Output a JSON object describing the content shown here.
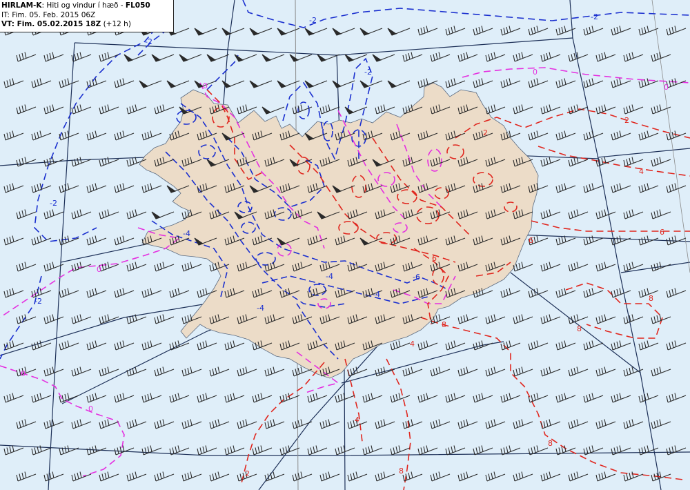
{
  "header": {
    "model": "HIRLAM-K",
    "subtitle": ": Hiti og vindur í hæð - ",
    "level": "FL050",
    "it_label": "IT: Fim. 05. Feb. 2015 06Z",
    "vt_label": "VT: Fim. 05.02.2015 18Z",
    "vt_lead": " (+12 h)"
  },
  "colors": {
    "sea": "#dfeef9",
    "land": "#ecdcc8",
    "grid": "#1c2f57",
    "meridian": "#8a8a8a",
    "cold_contour": "#1a2fcf",
    "zero_contour": "#e52fe0",
    "warm_contour": "#e0261e",
    "barb": "#2a2a2a"
  },
  "contour_labels": [
    {
      "text": "-2",
      "color": "cold"
    },
    {
      "text": "-2",
      "color": "cold"
    },
    {
      "text": "-2",
      "color": "cold"
    },
    {
      "text": "-2",
      "color": "cold"
    },
    {
      "text": "-2",
      "color": "cold"
    },
    {
      "text": "-2",
      "color": "cold"
    },
    {
      "text": "-4",
      "color": "cold"
    },
    {
      "text": "-4",
      "color": "cold"
    },
    {
      "text": "-4",
      "color": "cold"
    },
    {
      "text": "-4",
      "color": "cold"
    },
    {
      "text": "-6",
      "color": "cold"
    },
    {
      "text": "0",
      "color": "zero"
    },
    {
      "text": "0",
      "color": "zero"
    },
    {
      "text": "0",
      "color": "zero"
    },
    {
      "text": "0",
      "color": "zero"
    },
    {
      "text": "0",
      "color": "zero"
    },
    {
      "text": "0",
      "color": "zero"
    },
    {
      "text": "2",
      "color": "warm"
    },
    {
      "text": "2",
      "color": "warm"
    },
    {
      "text": "2",
      "color": "warm"
    },
    {
      "text": "4",
      "color": "warm"
    },
    {
      "text": "4",
      "color": "warm"
    },
    {
      "text": "4",
      "color": "warm"
    },
    {
      "text": "6",
      "color": "warm"
    },
    {
      "text": "6",
      "color": "warm"
    },
    {
      "text": "6",
      "color": "warm"
    },
    {
      "text": "8",
      "color": "warm"
    },
    {
      "text": "8",
      "color": "warm"
    },
    {
      "text": "8",
      "color": "warm"
    },
    {
      "text": "8",
      "color": "warm"
    },
    {
      "text": "8",
      "color": "warm"
    }
  ],
  "wind": {
    "direction": "southwest",
    "speed_knots_sea": 35,
    "speed_knots_northwest": 50
  }
}
